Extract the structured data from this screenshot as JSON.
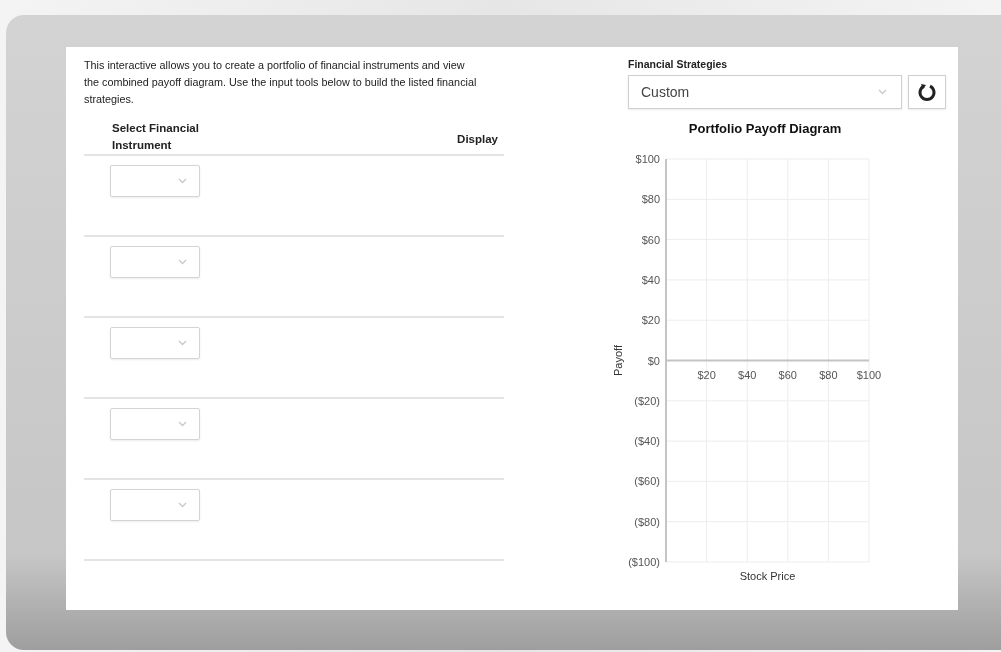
{
  "intro": "This interactive allows you to create a portfolio of financial instruments and view the combined payoff diagram. Use the input tools below to build the listed financial strategies.",
  "table": {
    "columns": [
      "Select Financial Instrument",
      "Display"
    ],
    "rows": [
      {
        "kind": "select"
      },
      {
        "kind": "select"
      },
      {
        "kind": "select"
      },
      {
        "kind": "select"
      },
      {
        "kind": "select"
      }
    ]
  },
  "strategy": {
    "label": "Financial Strategies",
    "value": "Custom"
  },
  "chart_data": {
    "type": "line",
    "title": "Portfolio Payoff Diagram",
    "xlabel": "Stock Price",
    "ylabel": "Payoff",
    "grid": true,
    "xlim": [
      0,
      100
    ],
    "ylim": [
      -100,
      100
    ],
    "xticks": [
      {
        "value": 20,
        "label": "$20"
      },
      {
        "value": 40,
        "label": "$40"
      },
      {
        "value": 60,
        "label": "$60"
      },
      {
        "value": 80,
        "label": "$80"
      },
      {
        "value": 100,
        "label": "$100"
      }
    ],
    "yticks": [
      {
        "value": 100,
        "label": "$100"
      },
      {
        "value": 80,
        "label": "$80"
      },
      {
        "value": 60,
        "label": "$60"
      },
      {
        "value": 40,
        "label": "$40"
      },
      {
        "value": 20,
        "label": "$20"
      },
      {
        "value": 0,
        "label": "$0"
      },
      {
        "value": -20,
        "label": "($20)"
      },
      {
        "value": -40,
        "label": "($40)"
      },
      {
        "value": -60,
        "label": "($60)"
      },
      {
        "value": -80,
        "label": "($80)"
      },
      {
        "value": -100,
        "label": "($100)"
      }
    ]
  }
}
